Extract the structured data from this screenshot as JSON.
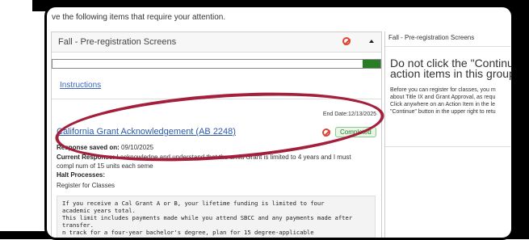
{
  "attention_text": "ve the following items that require your attention.",
  "left_panel": {
    "title": "Fall - Pre-registration Screens",
    "progress_fraction": 0.06,
    "instructions_link": "Instructions"
  },
  "item": {
    "end_date": "End Date:12/13/2025",
    "title": "California Grant Acknowledgement (AB 2248)",
    "status": "Completed",
    "response_saved_label": "Response saved on:",
    "response_saved_value": "09/10/2025",
    "current_response_label": "Current Response:",
    "current_response_value": "I acknowledge and understand that the        ornia Grant is limited to 4 years and I must",
    "current_response_cont": "compl      num of 15 units each seme",
    "halt_label": "Halt Processes:",
    "halt_value": "Register for Classes",
    "textbox_lines": [
      "  If you receive a Cal Grant A or B, your lifetime funding is limited to four",
      "academic years total.",
      "This limit includes payments made while you attend SBCC and any payments made after",
      "  transfer.",
      "  n track for a four-year bachelor's degree, plan for 15 degree-applicable"
    ]
  },
  "right_panel": {
    "title": "Fall - Pre-registration Screens",
    "heading_line1": "Do not click the \"Continue",
    "heading_line2": "action items in this group",
    "body_lines": [
      "Before you can register for classes, you m",
      "about Title IX and Grant Approval, as requ",
      "Click anywhere on an Action Item in the le",
      "\"Continue\" button in the upper right to retu"
    ]
  },
  "colors": {
    "progress": "#2a7d27",
    "link": "#2c58a8",
    "highlight_oval": "#a41f3b",
    "block_icon": "#dd4433"
  }
}
